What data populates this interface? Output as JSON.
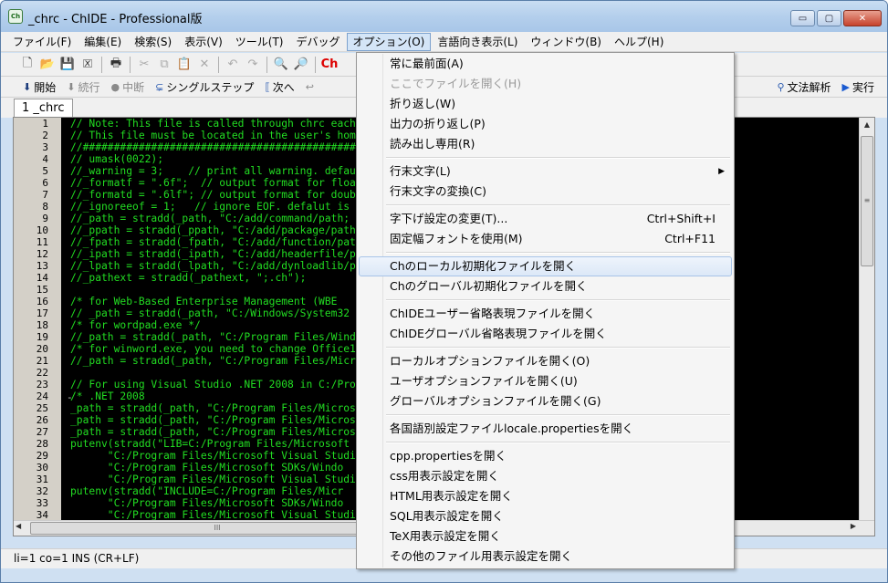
{
  "window": {
    "title": "_chrc - ChIDE - Professional版",
    "icon_label": "Ch",
    "controls": {
      "minimize": "▭",
      "maximize": "▢",
      "close": "✕"
    }
  },
  "menubar": [
    "ファイル(F)",
    "編集(E)",
    "検索(S)",
    "表示(V)",
    "ツール(T)",
    "デバッグ",
    "オプション(O)",
    "言語向き表示(L)",
    "ウィンドウ(B)",
    "ヘルプ(H)"
  ],
  "toolbar1": {
    "icons": [
      "new-file-icon",
      "open-folder-icon",
      "save-icon",
      "close-file-icon",
      "print-icon",
      "cut-icon",
      "copy-icon",
      "paste-icon",
      "delete-icon",
      "undo-icon",
      "redo-icon",
      "find-icon",
      "find-replace-icon",
      "ch-logo-icon"
    ],
    "ch_label": "Ch"
  },
  "toolbar2": {
    "start": "開始",
    "continue": "続行",
    "stop": "中断",
    "single_step": "シングルステップ",
    "next": "次へ",
    "syntax": "文法解析",
    "run": "実行"
  },
  "tab": {
    "label": "1 _chrc"
  },
  "editor": {
    "line_numbers": [
      "1",
      "2",
      "3",
      "4",
      "5",
      "6",
      "7",
      "8",
      "9",
      "10",
      "11",
      "12",
      "13",
      "14",
      "15",
      "16",
      "17",
      "18",
      "19",
      "20",
      "21",
      "22",
      "23",
      "24",
      "25",
      "26",
      "27",
      "28",
      "29",
      "30",
      "31",
      "32",
      "33",
      "34"
    ],
    "lines": [
      "// Note: This file is called through chrc each t",
      "// This file must be located in the user's home",
      "//################################################",
      "// umask(0022);",
      "//_warning = 3;    // print all warning. default",
      "//_formatf = \".6f\";  // output format for float",
      "//_formatd = \".6lf\"; // output format for double",
      "//_ignoreeof = 1;   // ignore EOF. defalut is 0",
      "//_path = stradd(_path, \"C:/add/command/path;",
      "//_ppath = stradd(_ppath, \"C:/add/package/path",
      "//_fpath = stradd(_fpath, \"C:/add/function/path",
      "//_ipath = stradd(_ipath, \"C:/add/headerfile/pat",
      "//_lpath = stradd(_lpath, \"C:/add/dynloadlib/pat",
      "//_pathext = stradd(_pathext, \";.ch\");",
      "",
      "/* for Web-Based Enterprise Management (WBE",
      "// _path = stradd(_path, \"C:/Windows/System32",
      "/* for wordpad.exe */",
      "//_path = stradd(_path, \"C:/Program Files/Wind",
      "/* for winword.exe, you need to change Office1",
      "//_path = stradd(_path, \"C:/Program Files/Micr",
      "",
      "// For using Visual Studio .NET 2008 in C:/Pro",
      "/* .NET 2008",
      "_path = stradd(_path, \"C:/Program Files/Micros",
      "_path = stradd(_path, \"C:/Program Files/Micros",
      "_path = stradd(_path, \"C:/Program Files/Micros",
      "putenv(stradd(\"LIB=C:/Program Files/Microsoft",
      "      \"C:/Program Files/Microsoft Visual Studi",
      "      \"C:/Program Files/Microsoft SDKs/Windo",
      "      \"C:/Program Files/Microsoft Visual Studi",
      "putenv(stradd(\"INCLUDE=C:/Program Files/Micr",
      "      \"C:/Program Files/Microsoft SDKs/Windo",
      "      \"C:/Program Files/Microsoft Visual Studi"
    ],
    "fold_marker": "-",
    "code_color": "#22dd22"
  },
  "status": {
    "text": "li=1 co=1 INS (CR+LF)"
  },
  "options_menu": {
    "groups": [
      [
        {
          "label": "常に最前面(A)"
        },
        {
          "label": "ここでファイルを開く(H)",
          "disabled": true
        },
        {
          "label": "折り返し(W)"
        },
        {
          "label": "出力の折り返し(P)"
        },
        {
          "label": "読み出し専用(R)"
        }
      ],
      [
        {
          "label": "行末文字(L)",
          "submenu": true
        },
        {
          "label": "行末文字の変換(C)"
        }
      ],
      [
        {
          "label": "字下げ設定の変更(T)...",
          "shortcut": "Ctrl+Shift+I"
        },
        {
          "label": "固定幅フォントを使用(M)",
          "shortcut": "Ctrl+F11"
        }
      ],
      [
        {
          "label": "Chのローカル初期化ファイルを開く",
          "highlighted": true
        },
        {
          "label": "Chのグローバル初期化ファイルを開く"
        }
      ],
      [
        {
          "label": "ChIDEユーザー省略表現ファイルを開く"
        },
        {
          "label": "ChIDEグローバル省略表現ファイルを開く"
        }
      ],
      [
        {
          "label": "ローカルオプションファイルを開く(O)"
        },
        {
          "label": "ユーザオプションファイルを開く(U)"
        },
        {
          "label": "グローバルオプションファイルを開く(G)"
        }
      ],
      [
        {
          "label": "各国語別設定ファイルlocale.propertiesを開く"
        }
      ],
      [
        {
          "label": "cpp.propertiesを開く"
        },
        {
          "label": "css用表示設定を開く"
        },
        {
          "label": "HTML用表示設定を開く"
        },
        {
          "label": "SQL用表示設定を開く"
        },
        {
          "label": "TeX用表示設定を開く"
        },
        {
          "label": "その他のファイル用表示設定を開く"
        }
      ]
    ],
    "submenu_arrow": "▶"
  },
  "colors": {
    "accent": "#7da2ce",
    "editor_bg": "#000000",
    "menu_bg": "#f5f5f5"
  }
}
